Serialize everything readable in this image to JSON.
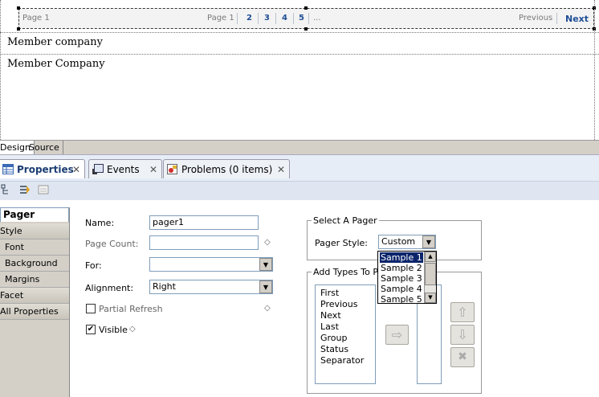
{
  "pager": {
    "left_label": "Page 1",
    "page_label": "Page 1",
    "pages": [
      "2",
      "3",
      "4",
      "5"
    ],
    "ellipsis": "...",
    "previous": "Previous",
    "next": "Next"
  },
  "rows": [
    "Member  company",
    "Member Company"
  ],
  "editor_tabs": {
    "design": "Design",
    "source": "Source"
  },
  "view_tabs": [
    {
      "label": "Properties",
      "close": "✕"
    },
    {
      "label": "Events",
      "close": "✕"
    },
    {
      "label": "Problems (0 items)",
      "close": "✕"
    }
  ],
  "nav": {
    "pager": "Pager",
    "style": "Style",
    "font": "Font",
    "background": "Background",
    "margins": "Margins",
    "facet": "Facet",
    "all_properties": "All Properties"
  },
  "form": {
    "name_label": "Name:",
    "name_value": "pager1",
    "page_count_label": "Page Count:",
    "page_count_value": "",
    "for_label": "For:",
    "for_value": "",
    "alignment_label": "Alignment:",
    "alignment_value": "Right",
    "partial_refresh_label": "Partial Refresh",
    "partial_refresh_checked": false,
    "visible_label": "Visible",
    "visible_checked": true
  },
  "select_pager": {
    "title": "Select A Pager",
    "style_label": "Pager Style:",
    "style_value": "Custom",
    "options": [
      "Sample 1",
      "Sample 2",
      "Sample 3",
      "Sample 4",
      "Sample 5"
    ],
    "highlighted": "Sample 1"
  },
  "add_types": {
    "title": "Add Types To Pa",
    "items": [
      "First",
      "Previous",
      "Next",
      "Last",
      "Group",
      "Status",
      "Separator"
    ]
  },
  "icons": {
    "diamond": "◇",
    "check": "✔",
    "dropdown_arrow": "▼",
    "scroll_up": "▲",
    "scroll_down": "▼",
    "move_right": "⇨",
    "move_up": "⇧",
    "move_down": "⇩",
    "remove": "✖"
  }
}
